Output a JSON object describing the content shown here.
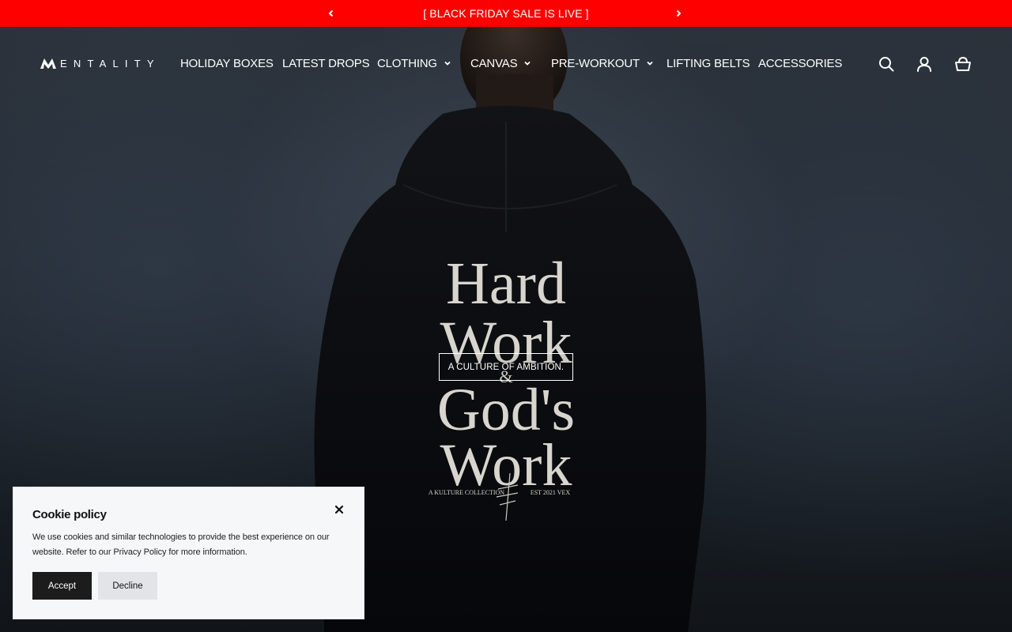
{
  "announcement": {
    "message": "[ BLACK FRIDAY SALE IS LIVE ]",
    "prev_icon": "chevron-left-icon",
    "next_icon": "chevron-right-icon",
    "background": "#ff0000"
  },
  "header": {
    "logo_text": "ENTALITY",
    "nav": [
      {
        "label": "HOLIDAY BOXES"
      },
      {
        "label": "LATEST DROPS"
      },
      {
        "label": "CLOTHING",
        "dropdown": true
      },
      {
        "label": "CANVAS",
        "dropdown": true
      },
      {
        "label": "PRE-WORKOUT",
        "dropdown": true
      },
      {
        "label": "LIFTING BELTS"
      },
      {
        "label": "ACCESSORIES"
      }
    ],
    "icons": [
      "search-icon",
      "account-icon",
      "cart-icon"
    ]
  },
  "hero": {
    "cta_label": "A CULTURE OF AMBITION.",
    "hoodie_print": [
      "Hard",
      "Work",
      "&",
      "God's",
      "Work"
    ],
    "hoodie_small": [
      "A KULTURE COLLECTION",
      "EST 2021 VEX"
    ]
  },
  "cookie": {
    "title": "Cookie policy",
    "body": "We use cookies and similar technologies to provide the best experience on our website. Refer to our Privacy Policy for more information.",
    "accept_label": "Accept",
    "decline_label": "Decline",
    "close_icon": "close-icon"
  }
}
